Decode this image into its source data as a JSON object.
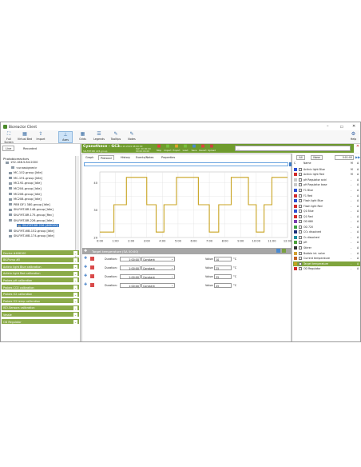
{
  "window": {
    "title": "Bioreactor Client"
  },
  "ribbon": [
    {
      "label": "Full Screen",
      "icon": "fullscreen-icon"
    },
    {
      "label": "Virtual Bed",
      "icon": "virtual-bed-icon"
    },
    {
      "label": "Import",
      "icon": "import-icon"
    },
    {
      "label": "Axes",
      "icon": "axes-icon"
    },
    {
      "label": "Grids",
      "icon": "grids-icon"
    },
    {
      "label": "Legends",
      "icon": "legends-icon"
    },
    {
      "label": "Tooltips",
      "icon": "tooltips-icon"
    },
    {
      "label": "Notes",
      "icon": "notes-icon"
    }
  ],
  "help_label": "Help",
  "left": {
    "tabs": [
      "Live",
      "Recorded"
    ],
    "tree_header": "Photobioreactors",
    "host": "192.168.5.84:2000",
    "nodes": [
      "<unassigned>",
      "MC-102-group [Idle]",
      "MC-191-group [Idle]",
      "MC192-group [Idle]",
      "MC204-group [Idle]",
      "MC206-group [Idle]",
      "MC208-group [Idle]",
      "PBR DF1 380-group [Idle]",
      "SN-FMT-BR-148-group [Idle]",
      "SN-FMT-BR-175-group [Rec]",
      "SN-FMT-BR-226-group [Idle]",
      "SN-FMT-BR 226 [466100]",
      "SN-FMT-WB-152-group [Idle]",
      "SN-FMT-WB-174-group [Idle]"
    ],
    "groups": [
      "Device #466100",
      "BK-Pump #0",
      "Actinic light Blue calibration",
      "Actinic light Red calibration",
      "Probes pH calibration",
      "Probes CO2 calibration",
      "Probes O2 calibration",
      "Probes O2 temp calibration",
      "ISO-Sensors calibration",
      "Vessle",
      "OD Regulator"
    ]
  },
  "device": {
    "name": "Cyanothece - GC3",
    "sub1": "14.10.2019 08:00:00",
    "sub2": "SN-FMT-BR 226 group",
    "sub3": "Ref: 00:00:00",
    "sub4": "00:00:00.00",
    "tools": [
      "Stop",
      "Import",
      "Export",
      "Load",
      "Save",
      "Revert",
      "Upload"
    ],
    "path": "..."
  },
  "main": {
    "tabs": [
      "Graph",
      "Protocol",
      "History",
      "Events/Notes",
      "Properties"
    ],
    "section_title": "Target temperature (SA 00:00)"
  },
  "chart_data": {
    "type": "line",
    "x": [
      "0:00",
      "1:00",
      "2:00",
      "3:00",
      "4:00",
      "5:00",
      "6:00",
      "7:00",
      "8:00",
      "9:00",
      "10:00",
      "11:00",
      "12:00"
    ],
    "ylim": [
      20,
      44
    ],
    "yticks": [
      20,
      30,
      40
    ],
    "series": [
      {
        "color": "#c8a320",
        "points": [
          [
            0,
            22
          ],
          [
            0.9,
            22
          ],
          [
            0.9,
            32
          ],
          [
            1.7,
            32
          ],
          [
            1.7,
            42
          ],
          [
            3.0,
            42
          ],
          [
            3.0,
            32
          ],
          [
            3.6,
            32
          ],
          [
            3.6,
            22
          ],
          [
            4.1,
            22
          ],
          [
            4.1,
            32
          ],
          [
            4.9,
            32
          ],
          [
            4.9,
            42
          ],
          [
            6.3,
            42
          ],
          [
            6.3,
            32
          ],
          [
            7.0,
            32
          ],
          [
            7.0,
            22
          ],
          [
            7.6,
            22
          ],
          [
            7.6,
            32
          ],
          [
            8.4,
            32
          ],
          [
            8.4,
            42
          ],
          [
            9.5,
            42
          ],
          [
            9.5,
            32
          ],
          [
            10.0,
            32
          ],
          [
            10.0,
            22
          ],
          [
            10.5,
            22
          ],
          [
            10.5,
            32
          ],
          [
            11.0,
            32
          ],
          [
            11.0,
            42
          ],
          [
            12.0,
            42
          ]
        ]
      }
    ]
  },
  "steps": [
    {
      "duration": "1:00:00",
      "mode": "Constant",
      "value": "10",
      "unit": "°C",
      "color": "#d94a4a"
    },
    {
      "duration": "1:00:00",
      "mode": "Constant",
      "value": "25",
      "unit": "°C",
      "color": "#d94a4a"
    },
    {
      "duration": "1:00:00",
      "mode": "Constant",
      "value": "35",
      "unit": "°C",
      "color": "#d94a4a"
    },
    {
      "duration": "1:00:00",
      "mode": "Constant",
      "value": "45",
      "unit": "°C",
      "color": "#d94a4a"
    }
  ],
  "step_labels": {
    "duration": "Duration:",
    "value": "Value:"
  },
  "right": {
    "all": "All",
    "none": "None",
    "time": "0:01:00",
    "headers": [
      "C",
      "Name",
      "M",
      "A"
    ],
    "rows": [
      {
        "c": "#2a4fd2",
        "n": "Actinic light Blue",
        "m": "M",
        "a": "A"
      },
      {
        "c": "#d22a2a",
        "n": "Actinic light Red",
        "m": "M",
        "a": "A"
      },
      {
        "c": "#c9c9c9",
        "n": "pH Regulator acid",
        "m": "-",
        "a": "A"
      },
      {
        "c": "#c9c9c9",
        "n": "pH Regulator base",
        "m": "-",
        "a": "A"
      },
      {
        "c": "#2a4fd2",
        "n": "F1 Blue",
        "m": "-",
        "a": "A"
      },
      {
        "c": "#d22a2a",
        "n": "F1 Red",
        "m": "-",
        "a": "A"
      },
      {
        "c": "#2a4fd2",
        "n": "Flash light Blue",
        "m": "-",
        "a": "A"
      },
      {
        "c": "#d22a2a",
        "n": "Flash light Red",
        "m": "-",
        "a": "A"
      },
      {
        "c": "#2a4fd2",
        "n": "Q1 Blue",
        "m": "-",
        "a": "A"
      },
      {
        "c": "#d22a2a",
        "n": "Q1 Red",
        "m": "-",
        "a": "A"
      },
      {
        "c": "#7a3ab0",
        "n": "OD 680",
        "m": "-",
        "a": "A"
      },
      {
        "c": "#3aa040",
        "n": "OD 720",
        "m": "-",
        "a": "A"
      },
      {
        "c": "#1b2f7a",
        "n": "CO₂ dissolved",
        "m": "-",
        "a": "A"
      },
      {
        "c": "#1a8fa0",
        "n": "O₂ dissolved",
        "m": "-",
        "a": "A"
      },
      {
        "c": "#4aa03a",
        "n": "pH",
        "m": "-",
        "a": "A"
      },
      {
        "c": "#333333",
        "n": "Stirrer",
        "m": "-",
        "a": "A"
      },
      {
        "c": "#d2a030",
        "n": "Bubble int. valve",
        "m": "-",
        "a": "A"
      },
      {
        "c": "#c06020",
        "n": "Current temperature",
        "m": "-",
        "a": "A"
      },
      {
        "c": "#c8a320",
        "n": "Target temperature",
        "m": "-",
        "a": "A",
        "sel": true
      },
      {
        "c": "#d22a2a",
        "n": "OD Regulator",
        "m": "-",
        "a": "A"
      }
    ]
  }
}
